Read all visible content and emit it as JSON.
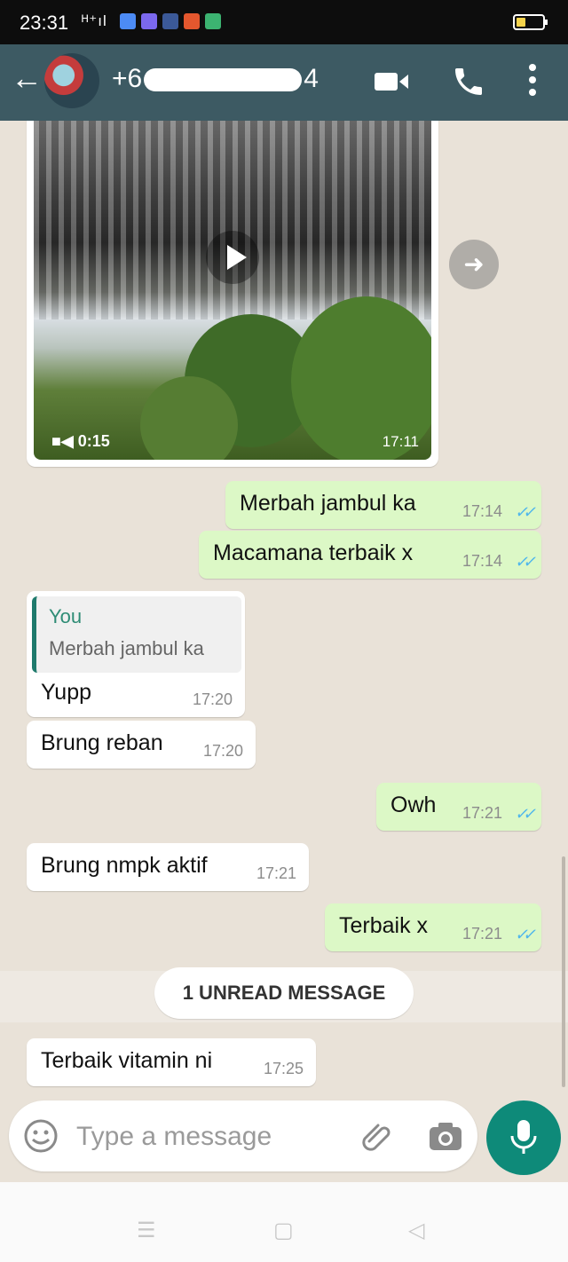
{
  "status_bar": {
    "time": "23:31",
    "network": "ᴴ⁺ıl"
  },
  "header": {
    "contact_prefix": "+6",
    "contact_suffix": "4"
  },
  "video": {
    "duration": "0:15",
    "time": "17:11"
  },
  "messages": [
    {
      "dir": "out",
      "text": "Merbah jambul ka",
      "time": "17:14"
    },
    {
      "dir": "out",
      "text": "Macamana terbaik x",
      "time": "17:14"
    },
    {
      "dir": "in",
      "quote_author": "You",
      "quote_text": "Merbah jambul ka",
      "text": "Yupp",
      "time": "17:20"
    },
    {
      "dir": "in",
      "text": "Brung reban",
      "time": "17:20"
    },
    {
      "dir": "out",
      "text": "Owh",
      "time": "17:21"
    },
    {
      "dir": "in",
      "text": "Brung nmpk aktif",
      "time": "17:21"
    },
    {
      "dir": "out",
      "text": "Terbaik x",
      "time": "17:21"
    },
    {
      "dir": "in",
      "text": "Terbaik vitamin ni",
      "time": "17:25"
    }
  ],
  "unread_label": "1 UNREAD MESSAGE",
  "composer": {
    "placeholder": "Type a message"
  },
  "colors": {
    "header": "#3d5a63",
    "outgoing_bubble": "#dcf8c6",
    "mic_button": "#0e8a79",
    "read_tick": "#4fb6ec"
  },
  "icons": [
    "back-arrow-icon",
    "video-call-icon",
    "phone-icon",
    "more-vert-icon",
    "forward-icon",
    "play-icon",
    "video-camera-icon",
    "emoji-icon",
    "attach-icon",
    "camera-icon",
    "mic-icon"
  ]
}
